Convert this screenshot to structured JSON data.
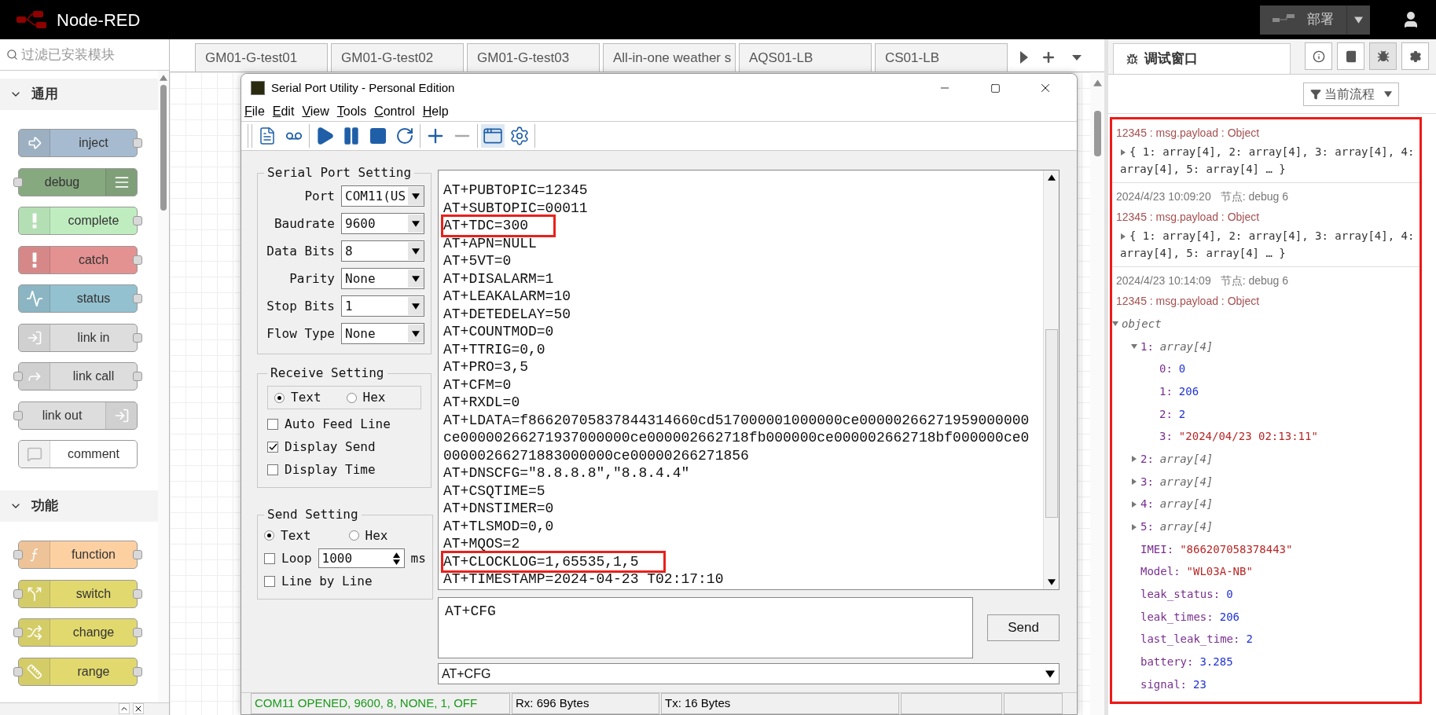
{
  "app": {
    "title": "Node-RED",
    "deploy": "部署"
  },
  "palette": {
    "placeholder": "过滤已安装模块",
    "categories": [
      {
        "label": "通用",
        "expanded": true,
        "nodes": [
          {
            "label": "inject",
            "color": "#a6bbcf",
            "kind": "left",
            "input": false,
            "output": true
          },
          {
            "label": "debug",
            "color": "#87a980",
            "kind": "right",
            "input": true,
            "output": false
          },
          {
            "label": "complete",
            "color": "#c0edc0",
            "kind": "left",
            "input": false,
            "output": true
          },
          {
            "label": "catch",
            "color": "#e49191",
            "kind": "left",
            "input": false,
            "output": true
          },
          {
            "label": "status",
            "color": "#94c1d0",
            "kind": "left",
            "input": false,
            "output": true
          },
          {
            "label": "link in",
            "color": "#dddddd",
            "kind": "left",
            "input": false,
            "output": true
          },
          {
            "label": "link call",
            "color": "#dddddd",
            "kind": "left",
            "input": true,
            "output": true
          },
          {
            "label": "link out",
            "color": "#dddddd",
            "kind": "right",
            "input": true,
            "output": false
          },
          {
            "label": "comment",
            "color": "#ffffff",
            "kind": "left",
            "input": false,
            "output": false
          }
        ]
      },
      {
        "label": "功能",
        "expanded": true,
        "nodes": [
          {
            "label": "function",
            "color": "#fdd0a2",
            "kind": "left",
            "input": true,
            "output": true
          },
          {
            "label": "switch",
            "color": "#e2d96e",
            "kind": "left",
            "input": true,
            "output": true
          },
          {
            "label": "change",
            "color": "#e2d96e",
            "kind": "left",
            "input": true,
            "output": true
          },
          {
            "label": "range",
            "color": "#e2d96e",
            "kind": "left",
            "input": true,
            "output": true
          }
        ]
      }
    ]
  },
  "workspace": {
    "tabs": [
      "GM01-G-test01",
      "GM01-G-test02",
      "GM01-G-test03",
      "All-in-one weather s",
      "AQS01-LB",
      "CS01-LB"
    ]
  },
  "serial": {
    "title": "Serial Port Utility - Personal Edition",
    "menu": [
      "File",
      "Edit",
      "View",
      "Tools",
      "Control",
      "Help"
    ],
    "port_setting": {
      "title": "Serial Port Setting",
      "fields": [
        {
          "label": "Port",
          "value": "COM11(US"
        },
        {
          "label": "Baudrate",
          "value": "9600"
        },
        {
          "label": "Data Bits",
          "value": "8"
        },
        {
          "label": "Parity",
          "value": "None"
        },
        {
          "label": "Stop Bits",
          "value": "1"
        },
        {
          "label": "Flow Type",
          "value": "None"
        }
      ]
    },
    "receive_setting": {
      "title": "Receive Setting",
      "modes": [
        {
          "label": "Text",
          "selected": true
        },
        {
          "label": "Hex",
          "selected": false
        }
      ],
      "options": [
        {
          "label": "Auto Feed Line",
          "checked": false
        },
        {
          "label": "Display Send",
          "checked": true
        },
        {
          "label": "Display Time",
          "checked": false
        }
      ]
    },
    "send_setting": {
      "title": "Send Setting",
      "modes": [
        {
          "label": "Text",
          "selected": true
        },
        {
          "label": "Hex",
          "selected": false
        }
      ],
      "loop": {
        "label": "Loop",
        "checked": false,
        "value": "1000",
        "unit": "ms"
      },
      "options": [
        {
          "label": "Line by Line",
          "checked": false
        }
      ]
    },
    "terminal": [
      {
        "text": "AT+PUBTOPIC=12345",
        "highlighted": false
      },
      {
        "text": "AT+SUBTOPIC=00011",
        "highlighted": false
      },
      {
        "text": "AT+TDC=300",
        "highlighted": true
      },
      {
        "text": "AT+APN=NULL",
        "highlighted": false
      },
      {
        "text": "AT+5VT=0",
        "highlighted": false
      },
      {
        "text": "AT+DISALARM=1",
        "highlighted": false
      },
      {
        "text": "AT+LEAKALARM=10",
        "highlighted": false
      },
      {
        "text": "AT+DETEDELAY=50",
        "highlighted": false
      },
      {
        "text": "AT+COUNTMOD=0",
        "highlighted": false
      },
      {
        "text": "AT+TTRIG=0,0",
        "highlighted": false
      },
      {
        "text": "AT+PRO=3,5",
        "highlighted": false
      },
      {
        "text": "AT+CFM=0",
        "highlighted": false
      },
      {
        "text": "AT+RXDL=0",
        "highlighted": false
      },
      {
        "text": "AT+LDATA=f86620705837844314660cd517000001000000ce00000266271959000000ce00000266271937000000ce000002662718fb000000ce000002662718bf000000ce000000266271883000000ce00000266271856",
        "highlighted": false
      },
      {
        "text": "AT+DNSCFG=\"8.8.8.8\",\"8.8.4.4\"",
        "highlighted": false
      },
      {
        "text": "AT+CSQTIME=5",
        "highlighted": false
      },
      {
        "text": "AT+DNSTIMER=0",
        "highlighted": false
      },
      {
        "text": "AT+TLSMOD=0,0",
        "highlighted": false
      },
      {
        "text": "AT+MQOS=2",
        "highlighted": false
      },
      {
        "text": "AT+CLOCKLOG=1,65535,1,5",
        "highlighted": true
      },
      {
        "text": "AT+TIMESTAMP=2024-04-23 T02:17:10",
        "highlighted": false
      }
    ],
    "send_input": "AT+CFG",
    "send_button": "Send",
    "history": "AT+CFG",
    "status_bar": [
      {
        "text": "COM11 OPENED, 9600, 8, NONE, 1, OFF",
        "kind": "status"
      },
      {
        "text": "Rx: 696 Bytes",
        "kind": "counter"
      },
      {
        "text": "Tx: 16 Bytes",
        "kind": "counter"
      }
    ]
  },
  "sidebar": {
    "tab": "调试窗口",
    "buttons": [
      {
        "selected": false
      },
      {
        "selected": false
      },
      {
        "selected": true
      },
      {
        "selected": false
      }
    ],
    "filter": "当前流程",
    "highlighted": true,
    "messages": [
      {
        "topic": "12345 : msg.payload : Object",
        "summary": "{ 1: array[4], 2: array[4], 3: array[4], 4: array[4], 5: array[4] … }"
      },
      {
        "time": "2024/4/23 10:09:20",
        "node": "节点: debug 6",
        "topic": "12345 : msg.payload : Object",
        "summary": "{ 1: array[4], 2: array[4], 3: array[4], 4: array[4], 5: array[4] … }"
      },
      {
        "time": "2024/4/23 10:14:09",
        "node": "节点: debug 6",
        "topic": "12345 : msg.payload : Object",
        "tree": {
          "label": "object",
          "expanded": true,
          "children": [
            {
              "key": "1:",
              "value": "array[4]",
              "kind": "array",
              "expanded": true,
              "children": [
                {
                  "key": "0:",
                  "value": "0",
                  "kind": "number"
                },
                {
                  "key": "1:",
                  "value": "206",
                  "kind": "number"
                },
                {
                  "key": "2:",
                  "value": "2",
                  "kind": "number"
                },
                {
                  "key": "3:",
                  "value": "\"2024/04/23 02:13:11\"",
                  "kind": "string"
                }
              ]
            },
            {
              "key": "2:",
              "value": "array[4]",
              "kind": "array",
              "expanded": false
            },
            {
              "key": "3:",
              "value": "array[4]",
              "kind": "array",
              "expanded": false
            },
            {
              "key": "4:",
              "value": "array[4]",
              "kind": "array",
              "expanded": false
            },
            {
              "key": "5:",
              "value": "array[4]",
              "kind": "array",
              "expanded": false
            },
            {
              "key": "IMEI:",
              "value": "\"866207058378443\"",
              "kind": "string"
            },
            {
              "key": "Model:",
              "value": "\"WL03A-NB\"",
              "kind": "string"
            },
            {
              "key": "leak_status:",
              "value": "0",
              "kind": "number"
            },
            {
              "key": "leak_times:",
              "value": "206",
              "kind": "number"
            },
            {
              "key": "last_leak_time:",
              "value": "2",
              "kind": "number"
            },
            {
              "key": "battery:",
              "value": "3.285",
              "kind": "number"
            },
            {
              "key": "signal:",
              "value": "23",
              "kind": "number"
            }
          ]
        }
      }
    ]
  }
}
